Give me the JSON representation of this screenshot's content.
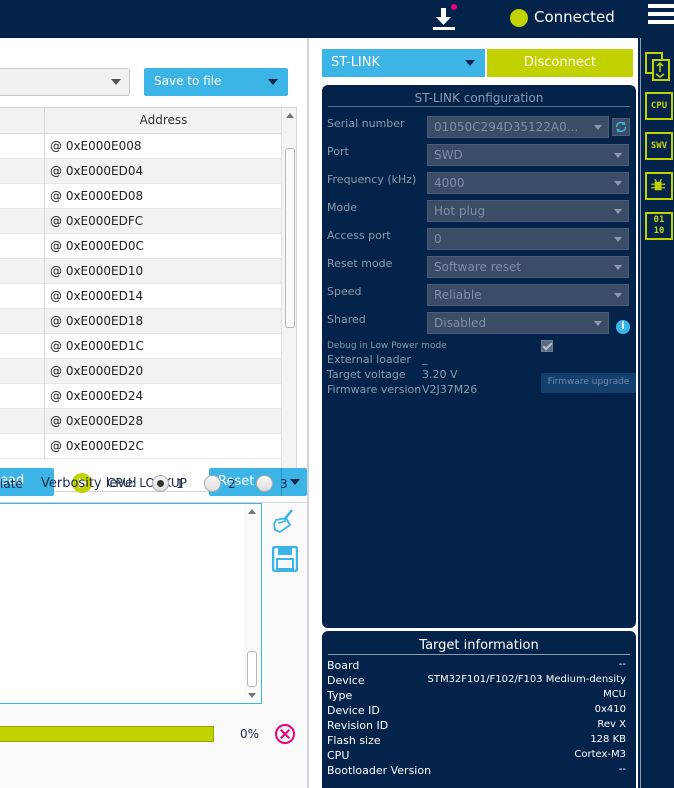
{
  "header": {
    "connection_status": "Connected",
    "status_color": "#c2d100",
    "download_icon": "download-icon",
    "menu_icon": "hamburger-menu-icon"
  },
  "memory": {
    "save_label": "Save to file",
    "address_header": "Address",
    "rows": [
      "@ 0xE000E008",
      "@ 0xE000ED04",
      "@ 0xE000ED08",
      "@ 0xE000EDFC",
      "@ 0xE000ED0C",
      "@ 0xE000ED10",
      "@ 0xE000ED14",
      "@ 0xE000ED18",
      "@ 0xE000ED1C",
      "@ 0xE000ED20",
      "@ 0xE000ED24",
      "@ 0xE000ED28",
      "@ 0xE000ED2C"
    ],
    "read_label": "ead",
    "cpu_status": "CPU: LOCKUP",
    "reset_label": "Reset"
  },
  "log": {
    "update_label": "late",
    "verbosity_label": "Verbosity level",
    "levels": [
      "1",
      "2",
      "3"
    ],
    "selected_level": "1",
    "progress_pct": "0%",
    "progress_fraction": 1.0
  },
  "stlink": {
    "probe_label": "ST-LINK",
    "disconnect_label": "Disconnect",
    "config_title": "ST-LINK configuration",
    "fields": {
      "serial_number": {
        "label": "Serial number",
        "value": "01050C294D35122A0..."
      },
      "port": {
        "label": "Port",
        "value": "SWD"
      },
      "frequency": {
        "label": "Frequency (kHz)",
        "value": "4000"
      },
      "mode": {
        "label": "Mode",
        "value": "Hot plug"
      },
      "access_port": {
        "label": "Access port",
        "value": "0"
      },
      "reset_mode": {
        "label": "Reset mode",
        "value": "Software reset"
      },
      "speed": {
        "label": "Speed",
        "value": "Reliable"
      },
      "shared": {
        "label": "Shared",
        "value": "Disabled"
      }
    },
    "debug_low_power": "Debug in Low Power mode",
    "external_loader": {
      "label": "External loader",
      "value": "_"
    },
    "target_voltage": {
      "label": "Target voltage",
      "value": "3.20 V"
    },
    "firmware_version": {
      "label": "Firmware version",
      "value": "V2J37M26"
    },
    "firmware_upgrade_label": "Firmware upgrade"
  },
  "target": {
    "title": "Target information",
    "rows": [
      {
        "k": "Board",
        "v": "--"
      },
      {
        "k": "Device",
        "v": "STM32F101/F102/F103 Medium-density"
      },
      {
        "k": "Type",
        "v": "MCU"
      },
      {
        "k": "Device ID",
        "v": "0x410"
      },
      {
        "k": "Revision ID",
        "v": "Rev X"
      },
      {
        "k": "Flash size",
        "v": "128 KB"
      },
      {
        "k": "CPU",
        "v": "Cortex-M3"
      },
      {
        "k": "Bootloader Version",
        "v": "--"
      }
    ]
  },
  "nav": {
    "items": [
      "CPU",
      "SWV",
      "01\n10"
    ]
  }
}
